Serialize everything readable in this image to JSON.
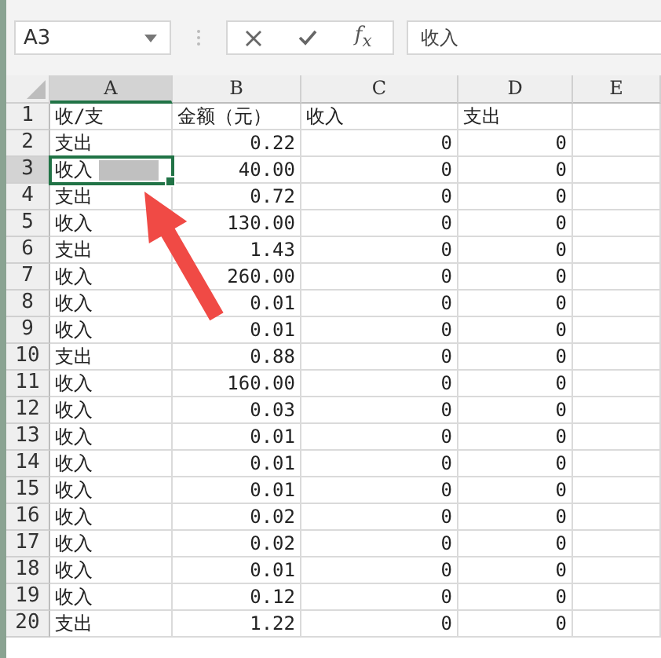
{
  "name_box": {
    "value": "A3"
  },
  "formula_bar": {
    "fx_label": "f$_{x}$",
    "value": "收入"
  },
  "pointer_arrow": true,
  "redaction_block": true,
  "columns": [
    {
      "label": "A",
      "selected": true
    },
    {
      "label": "B",
      "selected": false
    },
    {
      "label": "C",
      "selected": false
    },
    {
      "label": "D",
      "selected": false
    },
    {
      "label": "E",
      "selected": false
    }
  ],
  "rows": [
    {
      "number": "1",
      "kind": "header",
      "selected": false,
      "cells": [
        "收/支",
        "金额（元）",
        "收入",
        "支出"
      ]
    },
    {
      "number": "2",
      "kind": "data",
      "selected": false,
      "cells": [
        "支出",
        "0.22",
        "0",
        "0"
      ]
    },
    {
      "number": "3",
      "kind": "data",
      "selected": true,
      "cells": [
        "收入",
        "40.00",
        "0",
        "0"
      ]
    },
    {
      "number": "4",
      "kind": "data",
      "selected": false,
      "cells": [
        "支出",
        "0.72",
        "0",
        "0"
      ]
    },
    {
      "number": "5",
      "kind": "data",
      "selected": false,
      "cells": [
        "收入",
        "130.00",
        "0",
        "0"
      ]
    },
    {
      "number": "6",
      "kind": "data",
      "selected": false,
      "cells": [
        "支出",
        "1.43",
        "0",
        "0"
      ]
    },
    {
      "number": "7",
      "kind": "data",
      "selected": false,
      "cells": [
        "收入",
        "260.00",
        "0",
        "0"
      ]
    },
    {
      "number": "8",
      "kind": "data",
      "selected": false,
      "cells": [
        "收入",
        "0.01",
        "0",
        "0"
      ]
    },
    {
      "number": "9",
      "kind": "data",
      "selected": false,
      "cells": [
        "收入",
        "0.01",
        "0",
        "0"
      ]
    },
    {
      "number": "10",
      "kind": "data",
      "selected": false,
      "cells": [
        "支出",
        "0.88",
        "0",
        "0"
      ]
    },
    {
      "number": "11",
      "kind": "data",
      "selected": false,
      "cells": [
        "收入",
        "160.00",
        "0",
        "0"
      ]
    },
    {
      "number": "12",
      "kind": "data",
      "selected": false,
      "cells": [
        "收入",
        "0.03",
        "0",
        "0"
      ]
    },
    {
      "number": "13",
      "kind": "data",
      "selected": false,
      "cells": [
        "收入",
        "0.01",
        "0",
        "0"
      ]
    },
    {
      "number": "14",
      "kind": "data",
      "selected": false,
      "cells": [
        "收入",
        "0.01",
        "0",
        "0"
      ]
    },
    {
      "number": "15",
      "kind": "data",
      "selected": false,
      "cells": [
        "收入",
        "0.01",
        "0",
        "0"
      ]
    },
    {
      "number": "16",
      "kind": "data",
      "selected": false,
      "cells": [
        "收入",
        "0.02",
        "0",
        "0"
      ]
    },
    {
      "number": "17",
      "kind": "data",
      "selected": false,
      "cells": [
        "收入",
        "0.02",
        "0",
        "0"
      ]
    },
    {
      "number": "18",
      "kind": "data",
      "selected": false,
      "cells": [
        "收入",
        "0.01",
        "0",
        "0"
      ]
    },
    {
      "number": "19",
      "kind": "data",
      "selected": false,
      "cells": [
        "收入",
        "0.12",
        "0",
        "0"
      ]
    },
    {
      "number": "20",
      "kind": "data",
      "selected": false,
      "cells": [
        "支出",
        "1.22",
        "0",
        "0"
      ]
    }
  ]
}
